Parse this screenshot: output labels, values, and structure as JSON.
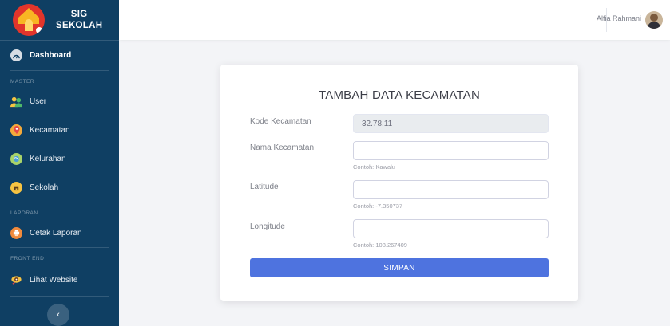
{
  "app": {
    "brand_line1": "SIG",
    "brand_line2": "SEKOLAH"
  },
  "sidebar": {
    "dashboard": "Dashboard",
    "heading_master": "MASTER",
    "user": "User",
    "kecamatan": "Kecamatan",
    "kelurahan": "Kelurahan",
    "sekolah": "Sekolah",
    "heading_laporan": "LAPORAN",
    "cetak": "Cetak Laporan",
    "heading_frontend": "FRONT END",
    "lihat": "Lihat Website",
    "toggle": "‹"
  },
  "topbar": {
    "user_name": "Alfia Rahmani"
  },
  "form": {
    "title": "TAMBAH DATA KECAMATAN",
    "kode_label": "Kode Kecamatan",
    "kode_value": "32.78.11",
    "nama_label": "Nama Kecamatan",
    "nama_hint": "Contoh: Kawalu",
    "lat_label": "Latitude",
    "lat_hint": "Contoh: -7.350737",
    "lon_label": "Longitude",
    "lon_hint": "Contoh: 108.267409",
    "submit": "SIMPAN"
  },
  "colors": {
    "sidebar": "#0f3f63",
    "primary": "#4e73df",
    "background": "#f3f4f7"
  }
}
